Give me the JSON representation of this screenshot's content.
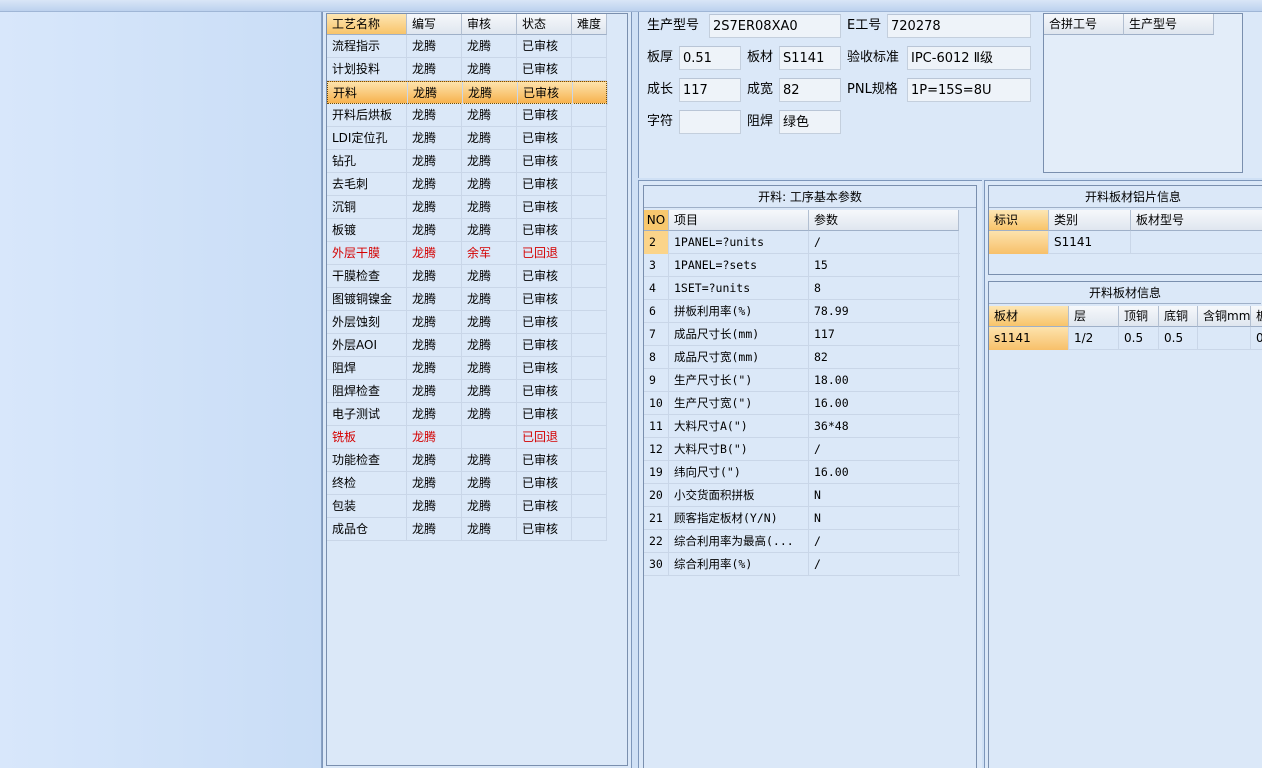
{
  "process_grid": {
    "headers": [
      "工艺名称",
      "编写",
      "审核",
      "状态",
      "难度"
    ],
    "rows": [
      {
        "name": "流程指示",
        "writer": "龙腾",
        "reviewer": "龙腾",
        "status": "已审核",
        "difficulty": "",
        "highlight": false
      },
      {
        "name": "计划投料",
        "writer": "龙腾",
        "reviewer": "龙腾",
        "status": "已审核",
        "difficulty": "",
        "highlight": false
      },
      {
        "name": "开料",
        "writer": "龙腾",
        "reviewer": "龙腾",
        "status": "已审核",
        "difficulty": "",
        "highlight": false,
        "selected": true
      },
      {
        "name": "开料后烘板",
        "writer": "龙腾",
        "reviewer": "龙腾",
        "status": "已审核",
        "difficulty": "",
        "highlight": false
      },
      {
        "name": "LDI定位孔",
        "writer": "龙腾",
        "reviewer": "龙腾",
        "status": "已审核",
        "difficulty": "",
        "highlight": false
      },
      {
        "name": "钻孔",
        "writer": "龙腾",
        "reviewer": "龙腾",
        "status": "已审核",
        "difficulty": "",
        "highlight": false
      },
      {
        "name": "去毛刺",
        "writer": "龙腾",
        "reviewer": "龙腾",
        "status": "已审核",
        "difficulty": "",
        "highlight": false
      },
      {
        "name": "沉铜",
        "writer": "龙腾",
        "reviewer": "龙腾",
        "status": "已审核",
        "difficulty": "",
        "highlight": false
      },
      {
        "name": "板镀",
        "writer": "龙腾",
        "reviewer": "龙腾",
        "status": "已审核",
        "difficulty": "",
        "highlight": false
      },
      {
        "name": "外层干膜",
        "writer": "龙腾",
        "reviewer": "余军",
        "status": "已回退",
        "difficulty": "",
        "highlight": true
      },
      {
        "name": "干膜检查",
        "writer": "龙腾",
        "reviewer": "龙腾",
        "status": "已审核",
        "difficulty": "",
        "highlight": false
      },
      {
        "name": "图镀铜镍金",
        "writer": "龙腾",
        "reviewer": "龙腾",
        "status": "已审核",
        "difficulty": "",
        "highlight": false
      },
      {
        "name": "外层蚀刻",
        "writer": "龙腾",
        "reviewer": "龙腾",
        "status": "已审核",
        "difficulty": "",
        "highlight": false
      },
      {
        "name": "外层AOI",
        "writer": "龙腾",
        "reviewer": "龙腾",
        "status": "已审核",
        "difficulty": "",
        "highlight": false
      },
      {
        "name": "阻焊",
        "writer": "龙腾",
        "reviewer": "龙腾",
        "status": "已审核",
        "difficulty": "",
        "highlight": false
      },
      {
        "name": "阻焊检查",
        "writer": "龙腾",
        "reviewer": "龙腾",
        "status": "已审核",
        "difficulty": "",
        "highlight": false
      },
      {
        "name": "电子测试",
        "writer": "龙腾",
        "reviewer": "龙腾",
        "status": "已审核",
        "difficulty": "",
        "highlight": false
      },
      {
        "name": "铣板",
        "writer": "龙腾",
        "reviewer": "",
        "status": "已回退",
        "difficulty": "",
        "highlight": true
      },
      {
        "name": "功能检查",
        "writer": "龙腾",
        "reviewer": "龙腾",
        "status": "已审核",
        "difficulty": "",
        "highlight": false
      },
      {
        "name": "终检",
        "writer": "龙腾",
        "reviewer": "龙腾",
        "status": "已审核",
        "difficulty": "",
        "highlight": false
      },
      {
        "name": "包装",
        "writer": "龙腾",
        "reviewer": "龙腾",
        "status": "已审核",
        "difficulty": "",
        "highlight": false
      },
      {
        "name": "成品仓",
        "writer": "龙腾",
        "reviewer": "龙腾",
        "status": "已审核",
        "difficulty": "",
        "highlight": false
      }
    ]
  },
  "info": {
    "model_label": "生产型号",
    "model_value": "2S7ER08XA0",
    "ejob_label": "E工号",
    "ejob_value": "720278",
    "thickness_label": "板厚",
    "thickness_value": "0.51",
    "material_label": "板材",
    "material_value": "S1141",
    "standard_label": "验收标准",
    "standard_value": "IPC-6012 Ⅱ级",
    "length_label": "成长",
    "length_value": "117",
    "width_label": "成宽",
    "width_value": "82",
    "pnl_label": "PNL规格",
    "pnl_value": "1P=15S=8U",
    "char_label": "字符",
    "char_value": "",
    "mask_label": "阻焊",
    "mask_value": "绿色"
  },
  "merge_grid": {
    "headers": [
      "合拼工号",
      "生产型号"
    ]
  },
  "params_panel": {
    "title": "开料: 工序基本参数",
    "headers": [
      "NO",
      "项目",
      "参数"
    ],
    "rows": [
      {
        "no": "2",
        "item": "1PANEL=?units",
        "value": "/"
      },
      {
        "no": "3",
        "item": "1PANEL=?sets",
        "value": "15"
      },
      {
        "no": "4",
        "item": "1SET=?units",
        "value": "8"
      },
      {
        "no": "6",
        "item": "拼板利用率(%)",
        "value": "78.99"
      },
      {
        "no": "7",
        "item": "成品尺寸长(mm)",
        "value": "117"
      },
      {
        "no": "8",
        "item": "成品尺寸宽(mm)",
        "value": "82"
      },
      {
        "no": "9",
        "item": "生产尺寸长(\")",
        "value": "18.00"
      },
      {
        "no": "10",
        "item": "生产尺寸宽(\")",
        "value": "16.00"
      },
      {
        "no": "11",
        "item": "大料尺寸A(\")",
        "value": "36*48"
      },
      {
        "no": "12",
        "item": "大料尺寸B(\")",
        "value": "/"
      },
      {
        "no": "19",
        "item": "纬向尺寸(\")",
        "value": "16.00"
      },
      {
        "no": "20",
        "item": "小交货面积拼板",
        "value": "N"
      },
      {
        "no": "21",
        "item": "顾客指定板材(Y/N)",
        "value": "N"
      },
      {
        "no": "22",
        "item": "综合利用率为最高(...",
        "value": "/"
      },
      {
        "no": "30",
        "item": "综合利用率(%)",
        "value": "/"
      }
    ]
  },
  "sheet_panel": {
    "title": "开料板材铝片信息",
    "headers": [
      "标识",
      "类别",
      "板材型号"
    ],
    "rows": [
      {
        "id": "",
        "category": "S1141",
        "model": ""
      }
    ]
  },
  "board_panel": {
    "title": "开料板材信息",
    "headers": [
      "板材",
      "层",
      "顶铜",
      "底铜",
      "含铜mm",
      "板"
    ],
    "rows": [
      {
        "material": "s1141",
        "layer": "1/2",
        "top": "0.5",
        "bottom": "0.5",
        "cu": "",
        "extra": "0."
      }
    ]
  },
  "colors": {
    "panel_bg": "#dbe8f8",
    "selected_row": "#f7b24e",
    "returned_text": "#d40000",
    "header_active": "#f8c46a"
  }
}
